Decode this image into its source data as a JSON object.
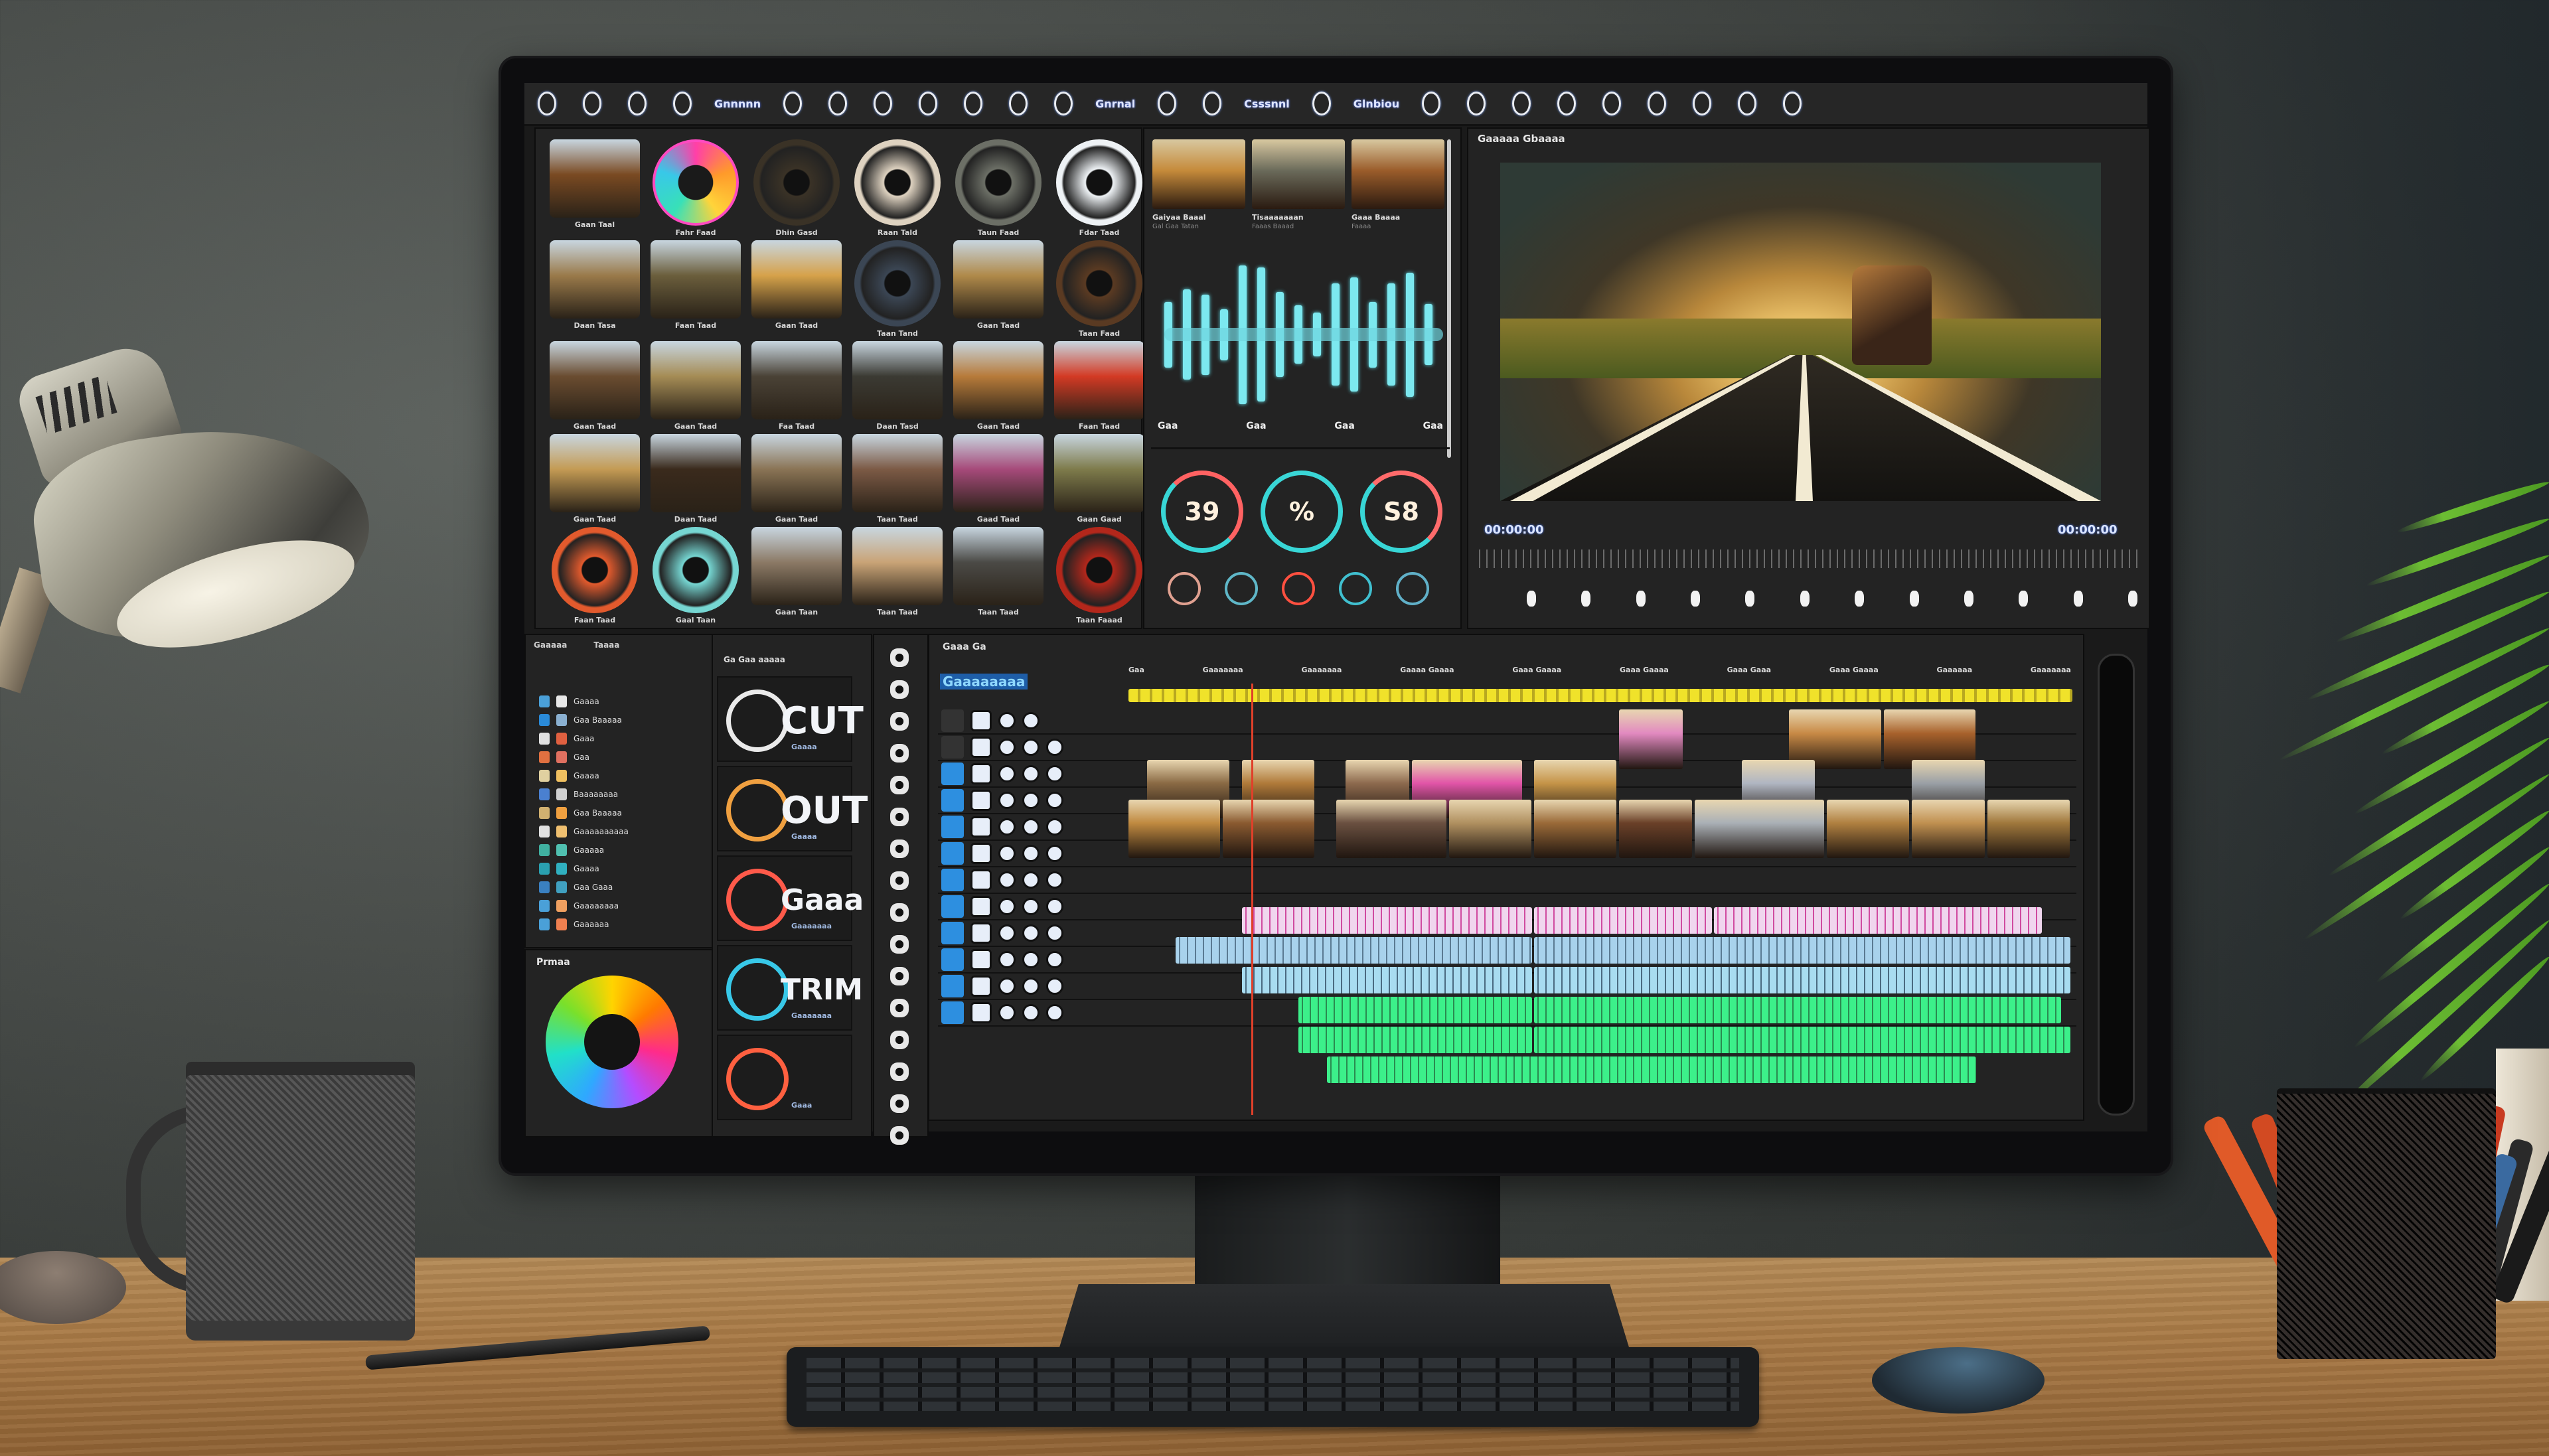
{
  "scene": {
    "description": "Desktop monitor displaying a video-editing application on a wooden desk",
    "objects": [
      "desk-lamp",
      "mesh-mug",
      "pencil",
      "monitor",
      "keyboard",
      "mouse",
      "pen-holder",
      "potted-plant"
    ]
  },
  "app": {
    "menubar": {
      "items": [
        {
          "icon": "settings-icon"
        },
        {
          "icon": "clock-icon"
        },
        {
          "icon": "info-icon"
        },
        {
          "icon": "flag-icon"
        },
        {
          "label": "Gnnnnn"
        },
        {
          "icon": "record-icon"
        },
        {
          "icon": "shield-icon"
        },
        {
          "icon": "power-icon"
        },
        {
          "icon": "target-icon"
        },
        {
          "icon": "link-icon"
        },
        {
          "icon": "layers-icon"
        },
        {
          "icon": "play-icon"
        },
        {
          "label": "Gnrnal"
        },
        {
          "icon": "info-icon"
        },
        {
          "icon": "edit-icon"
        },
        {
          "label": "Csssnnl"
        },
        {
          "icon": "audio-icon"
        },
        {
          "label": "Glnbiou"
        },
        {
          "icon": "cut-icon"
        },
        {
          "icon": "cycle-icon"
        },
        {
          "icon": "star-icon"
        },
        {
          "icon": "export-icon"
        },
        {
          "icon": "color-icon"
        },
        {
          "icon": "grade-icon"
        },
        {
          "icon": "folder-icon"
        },
        {
          "icon": "render-icon"
        },
        {
          "icon": "more-icon"
        }
      ]
    },
    "media_browser": {
      "items": [
        {
          "label": "Gaan Taal",
          "kind": "photo",
          "color": "#7a4a22"
        },
        {
          "label": "Fahr Faad",
          "kind": "color-wheel",
          "color": "#ff4ac0"
        },
        {
          "label": "Dhin Gasd",
          "kind": "dark-orb",
          "color": "#3a3226"
        },
        {
          "label": "Raan Tald",
          "kind": "ring",
          "color": "#ded2c0"
        },
        {
          "label": "Taun Faad",
          "kind": "orb",
          "color": "#6c6f66"
        },
        {
          "label": "Fdar Taad",
          "kind": "clock",
          "color": "#eef2f5"
        },
        {
          "label": "Daan Tasa",
          "kind": "landscape",
          "color": "#9a7a4a"
        },
        {
          "label": "Faan Taad",
          "kind": "landscape",
          "color": "#6b5e3c"
        },
        {
          "label": "Gaan Taad",
          "kind": "landscape",
          "color": "#d6a24a"
        },
        {
          "label": "Taan Tand",
          "kind": "dial",
          "color": "#3b4654"
        },
        {
          "label": "Gaan Taad",
          "kind": "landscape",
          "color": "#b08a4a"
        },
        {
          "label": "Taan Faad",
          "kind": "dial-orange",
          "color": "#5a3a22"
        },
        {
          "label": "Gaan Taad",
          "kind": "city",
          "color": "#6a4c30"
        },
        {
          "label": "Gaan Taad",
          "kind": "landscape",
          "color": "#a58c55"
        },
        {
          "label": "Faa Taad",
          "kind": "landscape",
          "color": "#4a4236"
        },
        {
          "label": "Daan Tasd",
          "kind": "night",
          "color": "#3b3a33"
        },
        {
          "label": "Gaan Taad",
          "kind": "scene",
          "color": "#b77b3a"
        },
        {
          "label": "Faan Taad",
          "kind": "red-icon",
          "color": "#d33a24"
        },
        {
          "label": "Gaan Taad",
          "kind": "landscape",
          "color": "#c49b54"
        },
        {
          "label": "Daan Taad",
          "kind": "fire",
          "color": "#3a2a1c"
        },
        {
          "label": "Gaan Taad",
          "kind": "landscape",
          "color": "#8a7455"
        },
        {
          "label": "Taan Taad",
          "kind": "scene",
          "color": "#7c5a45"
        },
        {
          "label": "Gaad Taad",
          "kind": "crowd",
          "color": "#a64a7a"
        },
        {
          "label": "Gaan Gaad",
          "kind": "landscape",
          "color": "#7e7b4b"
        },
        {
          "label": "Faan Taad",
          "kind": "lens",
          "color": "#e25a2d"
        },
        {
          "label": "Gaal Taan",
          "kind": "lens-teal",
          "color": "#76d6d2"
        },
        {
          "label": "Gaan Taan",
          "kind": "sky",
          "color": "#8c7a66"
        },
        {
          "label": "Taan Taad",
          "kind": "desert",
          "color": "#c9a477"
        },
        {
          "label": "Taan Taad",
          "kind": "dark",
          "color": "#4b4a46"
        },
        {
          "label": "Taan Faaad",
          "kind": "red-lens",
          "color": "#b3271b"
        }
      ]
    },
    "inspector": {
      "clips": [
        {
          "title": "Gaiyaa Baaal",
          "subtitle": "Gal Gaa Tatan",
          "color": "#c58a3a"
        },
        {
          "title": "Tisaaaaaaan",
          "subtitle": "Faaas Baaad",
          "color": "#6a6a5a"
        },
        {
          "title": "Gaaa Baaaa",
          "subtitle": "Faaaa",
          "color": "#9a5c2a"
        }
      ],
      "waveform_markers": [
        "Gaa",
        "Gaa",
        "Gaa",
        "Gaa"
      ],
      "waveform_levels": [
        0.45,
        0.62,
        0.55,
        0.35,
        0.95,
        0.92,
        0.58,
        0.4,
        0.3,
        0.7,
        0.78,
        0.45,
        0.7,
        0.85,
        0.42
      ],
      "gauges": [
        {
          "label": "39",
          "ring": "#ff6262"
        },
        {
          "label": "%",
          "ring": "#3ad6d6"
        },
        {
          "label": "S8",
          "ring": "#ff6b6b"
        }
      ],
      "knobs": [
        {
          "color": "#e0a090"
        },
        {
          "color": "#5fb7c8"
        },
        {
          "color": "#ff5040"
        },
        {
          "color": "#40c0d0"
        },
        {
          "color": "#60b0c8"
        }
      ]
    },
    "viewer": {
      "title": "Gaaaaa Gbaaaa",
      "timecode_left": "00:00:00",
      "timecode_right": "00:00:00",
      "transport": [
        "skip-start-icon",
        "prev-frame-icon",
        "play-back-icon",
        "stop-icon",
        "play-icon",
        "pause-icon",
        "record-icon",
        "mark-in-icon",
        "mark-out-icon",
        "next-frame-icon",
        "skip-end-icon",
        "fullscreen-icon"
      ]
    },
    "bins": {
      "tabs": [
        "Gaaaaa",
        "Taaaa"
      ],
      "items": [
        {
          "label": "Gaaaa",
          "colors": [
            "#4aa0d8",
            "#e8e8e8"
          ]
        },
        {
          "label": "Gaa Baaaaa",
          "colors": [
            "#2a8ad8",
            "#8ab0d0"
          ]
        },
        {
          "label": "Gaaa",
          "colors": [
            "#e0e0e0",
            "#e06040"
          ]
        },
        {
          "label": "Gaa",
          "colors": [
            "#e07040",
            "#e07060"
          ]
        },
        {
          "label": "Gaaaa",
          "colors": [
            "#e0d0a0",
            "#f0c060"
          ]
        },
        {
          "label": "Baaaaaaaa",
          "colors": [
            "#4a80d0",
            "#d0d0d0"
          ]
        },
        {
          "label": "Gaa Baaaaa",
          "colors": [
            "#d0b070",
            "#f0a040"
          ]
        },
        {
          "label": "Gaaaaaaaaaa",
          "colors": [
            "#e0e0e0",
            "#f0c070"
          ]
        },
        {
          "label": "Gaaaaa",
          "colors": [
            "#40b0a0",
            "#50c0b0"
          ]
        },
        {
          "label": "Gaaaa",
          "colors": [
            "#2aa0b0",
            "#30b0c0"
          ]
        },
        {
          "label": "Gaa Gaaa",
          "colors": [
            "#3a80c0",
            "#40a0c0"
          ]
        },
        {
          "label": "Gaaaaaaaa",
          "colors": [
            "#4aa0d8",
            "#f0a060"
          ]
        },
        {
          "label": "Gaaaaaa",
          "colors": [
            "#4aa0d8",
            "#f08050"
          ]
        }
      ],
      "color_panel_label": "Prmaa"
    },
    "tools": {
      "header": "Ga Gaa aaaaa",
      "items": [
        {
          "label": "CUT",
          "sub": "Gaaaa",
          "ring": "#eaeaea"
        },
        {
          "label": "OUT",
          "sub": "Gaaaa",
          "ring": "#f0a040"
        },
        {
          "label": "Gaaa",
          "sub": "Gaaaaaaa",
          "ring": "#ff5a4a"
        },
        {
          "label": "TRIM",
          "sub": "Gaaaaaaa",
          "ring": "#38c8e8"
        },
        {
          "label": "",
          "sub": "Gaaa",
          "ring": "#ff6040"
        }
      ]
    },
    "timeline": {
      "title": "Gaaa Ga",
      "sequence_name": "Gaaaaaaaa",
      "ruler_labels": [
        "Gaa",
        "Gaaaaaaa",
        "Gaaaaaaa",
        "Gaaaa Gaaaa",
        "Gaaa Gaaaa",
        "Gaaa Gaaaa",
        "Gaaa Gaaa",
        "Gaaa Gaaaa",
        "Gaaaaaa",
        "Gaaaaaaa"
      ],
      "playhead_position": 0.13,
      "marker_bar_color": "#f0e22a",
      "video_tracks": [
        {
          "clips": [
            {
              "start": 0.52,
              "end": 0.59,
              "color": "#e28ac0"
            },
            {
              "start": 0.7,
              "end": 0.8,
              "color": "#c88a46"
            },
            {
              "start": 0.8,
              "end": 0.9,
              "color": "#a8622c"
            }
          ]
        },
        {
          "clips": [
            {
              "start": 0.02,
              "end": 0.11,
              "color": "#8a6a44"
            },
            {
              "start": 0.12,
              "end": 0.2,
              "color": "#b07a3a"
            },
            {
              "start": 0.23,
              "end": 0.3,
              "color": "#8d6a4e"
            },
            {
              "start": 0.3,
              "end": 0.42,
              "color": "#e255a8"
            },
            {
              "start": 0.43,
              "end": 0.52,
              "color": "#c59448"
            },
            {
              "start": 0.65,
              "end": 0.73,
              "color": "#b0b6c2"
            },
            {
              "start": 0.83,
              "end": 0.91,
              "color": "#9aa0a6"
            }
          ]
        },
        {
          "clips": [
            {
              "start": 0.0,
              "end": 0.1,
              "color": "#c08a40"
            },
            {
              "start": 0.1,
              "end": 0.2,
              "color": "#8a5a30"
            },
            {
              "start": 0.22,
              "end": 0.34,
              "color": "#6a5040"
            },
            {
              "start": 0.34,
              "end": 0.43,
              "color": "#b09060"
            },
            {
              "start": 0.43,
              "end": 0.52,
              "color": "#9a6a38"
            },
            {
              "start": 0.52,
              "end": 0.6,
              "color": "#6a4028"
            },
            {
              "start": 0.6,
              "end": 0.74,
              "color": "#aab0b6"
            },
            {
              "start": 0.74,
              "end": 0.83,
              "color": "#b08040"
            },
            {
              "start": 0.83,
              "end": 0.91,
              "color": "#c09050"
            },
            {
              "start": 0.91,
              "end": 1.0,
              "color": "#a0783c"
            }
          ]
        }
      ],
      "audio_tracks": [
        {
          "color": "#f0d6ee",
          "accent": "#d04aa0",
          "clips": [
            {
              "start": 0.12,
              "end": 0.43
            },
            {
              "start": 0.43,
              "end": 0.62
            },
            {
              "start": 0.62,
              "end": 0.97
            }
          ]
        },
        {
          "color": "#a8d2ec",
          "accent": "#5a7a92",
          "clips": [
            {
              "start": 0.05,
              "end": 0.43
            },
            {
              "start": 0.43,
              "end": 1.0
            }
          ]
        },
        {
          "color": "#a8dcf0",
          "accent": "#4a6a80",
          "clips": [
            {
              "start": 0.12,
              "end": 0.43
            },
            {
              "start": 0.43,
              "end": 1.0
            }
          ]
        },
        {
          "color": "#3cf08a",
          "accent": "#2a8a50",
          "clips": [
            {
              "start": 0.18,
              "end": 0.43
            },
            {
              "start": 0.43,
              "end": 0.99
            }
          ]
        },
        {
          "color": "#3cf08a",
          "accent": "#2a8a50",
          "clips": [
            {
              "start": 0.18,
              "end": 0.43
            },
            {
              "start": 0.43,
              "end": 1.0
            }
          ]
        },
        {
          "color": "#3cf08a",
          "accent": "#2a8a50",
          "clips": [
            {
              "start": 0.21,
              "end": 0.9
            }
          ]
        }
      ],
      "track_count": 12
    }
  }
}
